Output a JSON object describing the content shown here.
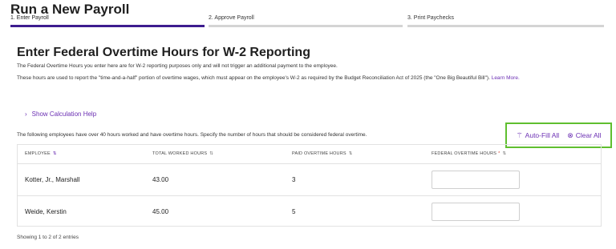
{
  "header": {
    "title": "Run a New Payroll"
  },
  "steps": [
    {
      "label": "1. Enter Payroll",
      "active": true
    },
    {
      "label": "2. Approve Payroll",
      "active": false
    },
    {
      "label": "3. Print Paychecks",
      "active": false
    }
  ],
  "section": {
    "title": "Enter Federal Overtime Hours for W-2 Reporting",
    "para1": "The Federal Overtime Hours you enter here are for W-2 reporting purposes only and will not trigger an additional payment to the employee.",
    "para2": "These hours are used to report the \"time-and-a-half\" portion of overtime wages, which must appear on the employee's W-2 as required by the Budget Reconciliation Act of 2025 (the \"One Big Beautiful Bill\").",
    "learn_more": "Learn More.",
    "calc_help": "Show Calculation Help",
    "intro": "The following employees have over 40 hours worked and have overtime hours. Specify the number of hours that should be considered federal overtime."
  },
  "actions": {
    "auto_fill": "Auto-Fill All",
    "clear_all": "Clear All"
  },
  "table": {
    "columns": [
      "EMPLOYEE",
      "TOTAL WORKED HOURS",
      "PAID OVERTIME HOURS",
      "FEDERAL OVERTIME HOURS"
    ],
    "required_mark": "*",
    "rows": [
      {
        "employee": "Kotter, Jr., Marshall",
        "total_worked": "43.00",
        "paid_overtime": "3",
        "federal_overtime": ""
      },
      {
        "employee": "Weide, Kerstin",
        "total_worked": "45.00",
        "paid_overtime": "5",
        "federal_overtime": ""
      }
    ]
  },
  "footer": {
    "entries": "Showing 1 to 2 of 2 entries"
  },
  "colors": {
    "accent": "#6b2fb3",
    "step_active": "#3d1c8f",
    "highlight_border": "#5fbf2f",
    "required": "#d23a2c"
  },
  "icons": {
    "auto_fill": "magic-wand-icon",
    "clear_all": "clear-x-icon",
    "sort": "sort-arrows-icon",
    "chevron": "chevron-right-icon"
  }
}
